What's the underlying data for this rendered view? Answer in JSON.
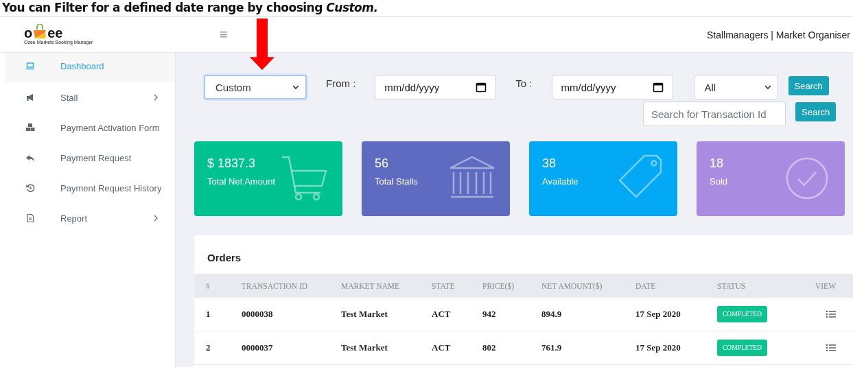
{
  "caption": "You can Filter for a defined date range by choosing *Custom.*",
  "logo": {
    "left": "o",
    "right": "ee",
    "tagline": "Ozee Markets Booking Manager"
  },
  "header": {
    "menu_icon": "≡",
    "user": "Stallmanagers | Market Organiser"
  },
  "sidebar": {
    "items": [
      {
        "label": "Dashboard",
        "kind": "laptop",
        "selected": true,
        "has_submenu": false
      },
      {
        "label": "Stall",
        "kind": "megaphone",
        "selected": false,
        "has_submenu": true
      },
      {
        "label": "Payment Activation Form",
        "kind": "cubes",
        "selected": false,
        "has_submenu": false
      },
      {
        "label": "Payment Request",
        "kind": "reply",
        "selected": false,
        "has_submenu": false
      },
      {
        "label": "Payment Request History",
        "kind": "history",
        "selected": false,
        "has_submenu": false
      },
      {
        "label": "Report",
        "kind": "file",
        "selected": false,
        "has_submenu": true
      }
    ]
  },
  "filters": {
    "range": {
      "value": "Custom"
    },
    "from_label": "From :",
    "from": {
      "placeholder": "mm/dd/yyyy"
    },
    "to_label": "To :",
    "to": {
      "placeholder": "mm/dd/yyyy"
    },
    "status": {
      "value": "All"
    },
    "search_button": "Search",
    "transaction_search": {
      "placeholder": "Search for Transaction Id"
    },
    "transaction_button": "Search"
  },
  "cards": [
    {
      "value": "$ 1837.3",
      "label": "Total Net Amount",
      "kind": "cart",
      "color": "#00c291"
    },
    {
      "value": "56",
      "label": "Total Stalls",
      "kind": "bank",
      "color": "#5e6bc0"
    },
    {
      "value": "38",
      "label": "Available",
      "kind": "tag",
      "color": "#03a9f4"
    },
    {
      "value": "18",
      "label": "Sold",
      "kind": "check",
      "color": "#aa8be2"
    }
  ],
  "orders": {
    "title": "Orders",
    "columns": [
      "#",
      "TRANSACTION ID",
      "MARKET NAME",
      "STATE",
      "PRICE($)",
      "NET AMOUNT($)",
      "DATE",
      "STATUS",
      "VIEW"
    ],
    "rows": [
      {
        "cells": [
          "1",
          "0000038",
          "Test Market",
          "ACT",
          "942",
          "894.9",
          "17 Sep 2020"
        ],
        "status": "COMPLETED"
      },
      {
        "cells": [
          "2",
          "0000037",
          "Test Market",
          "ACT",
          "802",
          "761.9",
          "17 Sep 2020"
        ],
        "status": "COMPLETED"
      }
    ]
  }
}
